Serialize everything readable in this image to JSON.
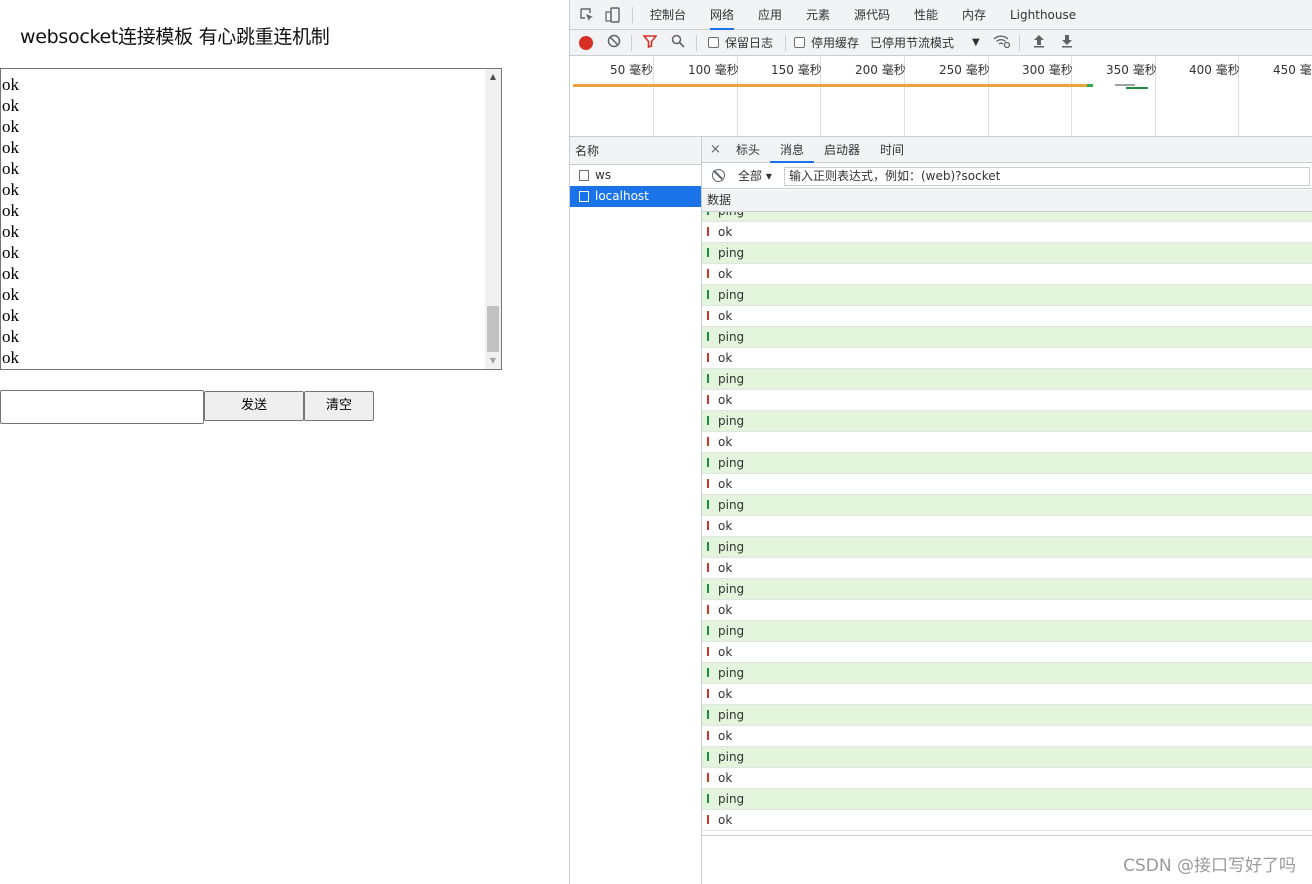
{
  "page": {
    "title": "websocket连接模板 有心跳重连机制",
    "log_lines": [
      "ok",
      "ok",
      "ok",
      "ok",
      "ok",
      "ok",
      "ok",
      "ok",
      "ok",
      "ok",
      "ok",
      "ok",
      "ok",
      "ok",
      "ok"
    ],
    "send_input_value": "",
    "send_button": "发送",
    "clear_button": "清空",
    "log_scroll_position": 0.92
  },
  "devtools": {
    "tabs": [
      {
        "label": "控制台",
        "active": false
      },
      {
        "label": "网络",
        "active": true
      },
      {
        "label": "应用",
        "active": false
      },
      {
        "label": "元素",
        "active": false
      },
      {
        "label": "源代码",
        "active": false
      },
      {
        "label": "性能",
        "active": false
      },
      {
        "label": "内存",
        "active": false
      },
      {
        "label": "Lighthouse",
        "active": false
      }
    ],
    "toolbar": {
      "preserve_log": "保留日志",
      "disable_cache": "停用缓存",
      "throttling": "已停用节流模式",
      "icons": [
        "record-icon",
        "clear-icon",
        "filter-icon",
        "search-icon",
        "wifi-settings-icon",
        "upload-icon",
        "download-icon"
      ],
      "record_color": "#d93025",
      "filter_color": "#d93025"
    },
    "timeline": {
      "labels": [
        "50 毫秒",
        "100 毫秒",
        "150 毫秒",
        "200 毫秒",
        "250 毫秒",
        "300 毫秒",
        "350 毫秒",
        "400 毫秒",
        "450 毫秒"
      ]
    },
    "requests": {
      "header": "名称",
      "items": [
        {
          "name": "ws",
          "selected": false
        },
        {
          "name": "localhost",
          "selected": true
        }
      ]
    },
    "detail": {
      "close": "×",
      "tabs": [
        {
          "label": "标头",
          "active": false
        },
        {
          "label": "消息",
          "active": true
        },
        {
          "label": "启动器",
          "active": false
        },
        {
          "label": "时间",
          "active": false
        }
      ],
      "filter_select": "全部 ▾",
      "filter_placeholder": "输入正则表达式，例如：(web)?socket",
      "data_header": "数据",
      "messages": [
        {
          "dir": "sent",
          "text": "ping"
        },
        {
          "dir": "recv",
          "text": "ok"
        },
        {
          "dir": "sent",
          "text": "ping"
        },
        {
          "dir": "recv",
          "text": "ok"
        },
        {
          "dir": "sent",
          "text": "ping"
        },
        {
          "dir": "recv",
          "text": "ok"
        },
        {
          "dir": "sent",
          "text": "ping"
        },
        {
          "dir": "recv",
          "text": "ok"
        },
        {
          "dir": "sent",
          "text": "ping"
        },
        {
          "dir": "recv",
          "text": "ok"
        },
        {
          "dir": "sent",
          "text": "ping"
        },
        {
          "dir": "recv",
          "text": "ok"
        },
        {
          "dir": "sent",
          "text": "ping"
        },
        {
          "dir": "recv",
          "text": "ok"
        },
        {
          "dir": "sent",
          "text": "ping"
        },
        {
          "dir": "recv",
          "text": "ok"
        },
        {
          "dir": "sent",
          "text": "ping"
        },
        {
          "dir": "recv",
          "text": "ok"
        },
        {
          "dir": "sent",
          "text": "ping"
        },
        {
          "dir": "recv",
          "text": "ok"
        },
        {
          "dir": "sent",
          "text": "ping"
        },
        {
          "dir": "recv",
          "text": "ok"
        },
        {
          "dir": "sent",
          "text": "ping"
        },
        {
          "dir": "recv",
          "text": "ok"
        },
        {
          "dir": "sent",
          "text": "ping"
        },
        {
          "dir": "recv",
          "text": "ok"
        },
        {
          "dir": "sent",
          "text": "ping"
        },
        {
          "dir": "recv",
          "text": "ok"
        },
        {
          "dir": "sent",
          "text": "ping"
        },
        {
          "dir": "recv",
          "text": "ok"
        }
      ]
    }
  },
  "watermark": "CSDN @接口写好了吗",
  "colors": {
    "accent": "#1a73e8",
    "sent_row": "#e2f4dc",
    "sent_arrow": "#1e8e3e",
    "recv_arrow": "#d93025",
    "timeline_bar": "#e8a33b"
  }
}
